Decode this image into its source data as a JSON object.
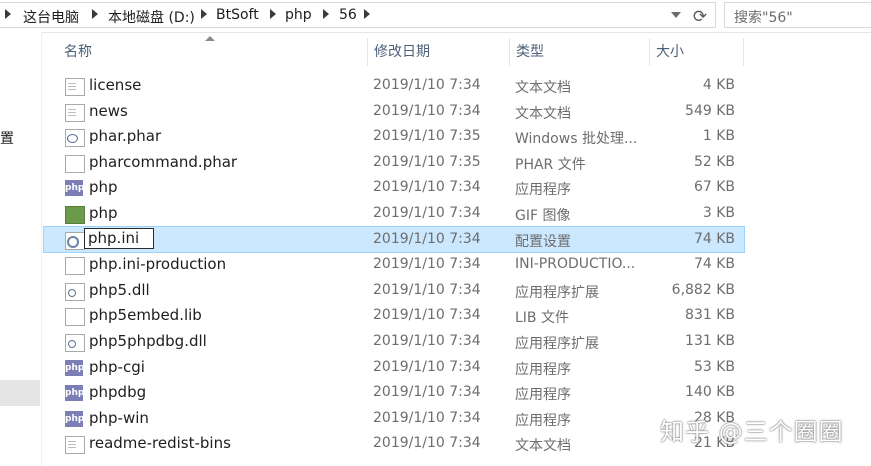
{
  "address_bar": {
    "breadcrumbs": [
      "这台电脑",
      "本地磁盘 (D:)",
      "BtSoft",
      "php",
      "56"
    ],
    "search_placeholder": "搜索\"56\""
  },
  "nav_pane": {
    "partial_item": "置"
  },
  "columns": {
    "name": "名称",
    "date": "修改日期",
    "type": "类型",
    "size": "大小"
  },
  "files": [
    {
      "name": "license",
      "date": "2019/1/10 7:34",
      "type": "文本文档",
      "size": "4 KB",
      "icon": "text-file-icon"
    },
    {
      "name": "news",
      "date": "2019/1/10 7:34",
      "type": "文本文档",
      "size": "549 KB",
      "icon": "text-file-icon"
    },
    {
      "name": "phar.phar",
      "date": "2019/1/10 7:35",
      "type": "Windows 批处理...",
      "size": "1 KB",
      "icon": "batch-file-icon"
    },
    {
      "name": "pharcommand.phar",
      "date": "2019/1/10 7:35",
      "type": "PHAR 文件",
      "size": "52 KB",
      "icon": "blank-file-icon"
    },
    {
      "name": "php",
      "date": "2019/1/10 7:34",
      "type": "应用程序",
      "size": "67 KB",
      "icon": "php-icon"
    },
    {
      "name": "php",
      "date": "2019/1/10 7:34",
      "type": "GIF 图像",
      "size": "3 KB",
      "icon": "gif-image-icon"
    },
    {
      "name": "php.ini",
      "date": "2019/1/10 7:34",
      "type": "配置设置",
      "size": "74 KB",
      "icon": "config-file-icon"
    },
    {
      "name": "php.ini-production",
      "date": "2019/1/10 7:34",
      "type": "INI-PRODUCTIO...",
      "size": "74 KB",
      "icon": "blank-file-icon"
    },
    {
      "name": "php5.dll",
      "date": "2019/1/10 7:34",
      "type": "应用程序扩展",
      "size": "6,882 KB",
      "icon": "dll-file-icon"
    },
    {
      "name": "php5embed.lib",
      "date": "2019/1/10 7:34",
      "type": "LIB 文件",
      "size": "831 KB",
      "icon": "blank-file-icon"
    },
    {
      "name": "php5phpdbg.dll",
      "date": "2019/1/10 7:34",
      "type": "应用程序扩展",
      "size": "131 KB",
      "icon": "dll-file-icon"
    },
    {
      "name": "php-cgi",
      "date": "2019/1/10 7:34",
      "type": "应用程序",
      "size": "53 KB",
      "icon": "php-icon"
    },
    {
      "name": "phpdbg",
      "date": "2019/1/10 7:34",
      "type": "应用程序",
      "size": "140 KB",
      "icon": "php-icon"
    },
    {
      "name": "php-win",
      "date": "2019/1/10 7:34",
      "type": "应用程序",
      "size": "28 KB",
      "icon": "php-icon"
    },
    {
      "name": "readme-redist-bins",
      "date": "2019/1/10 7:34",
      "type": "文本文档",
      "size": "21 KB",
      "icon": "text-file-icon"
    }
  ],
  "selected_file": "php.ini",
  "watermark": "知乎 @三个圈圈"
}
